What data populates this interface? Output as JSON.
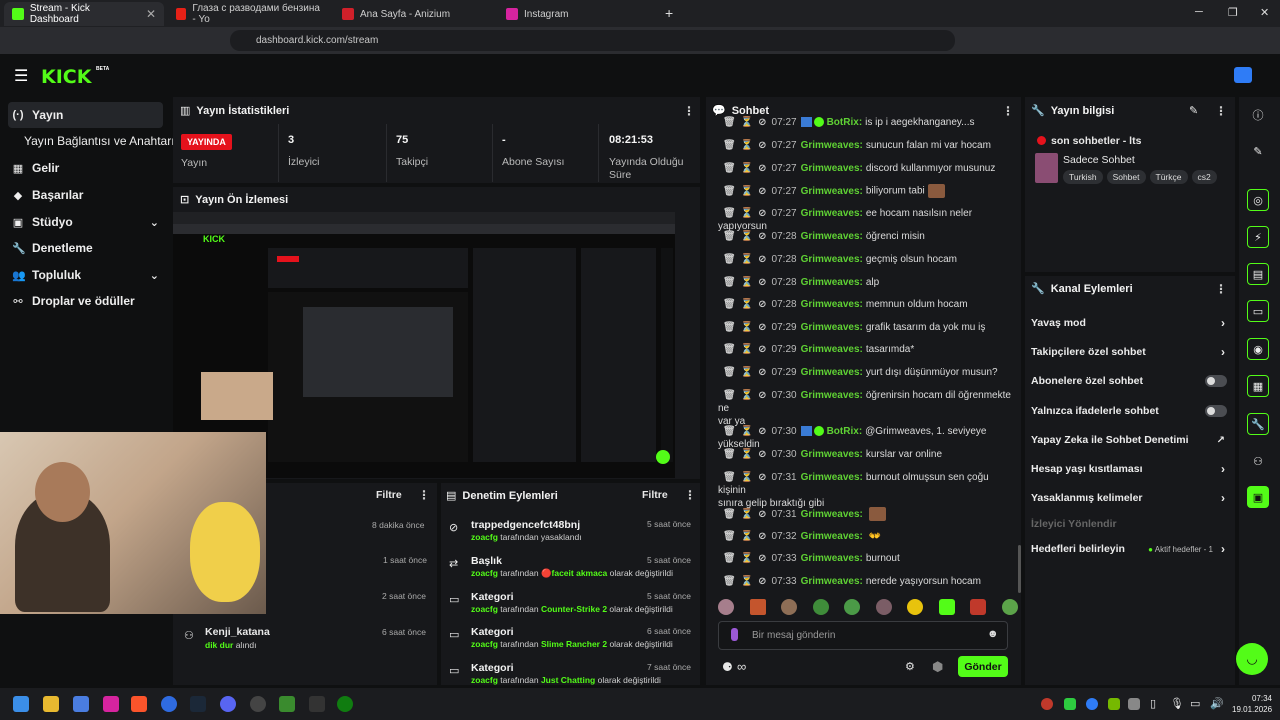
{
  "browser": {
    "tabs": [
      {
        "title": "Stream - Kick Dashboard",
        "color": "#53fc18"
      },
      {
        "title": "Глаза с разводами бензина - Yo",
        "color": "#e62117"
      },
      {
        "title": "Ana Sayfa - Anizium",
        "color": "#d0202a"
      },
      {
        "title": "Instagram",
        "color": "#d6249f"
      }
    ],
    "url": "dashboard.kick.com/stream",
    "new_tab": "+",
    "win_min": "─",
    "win_max": "❐",
    "win_close": "✕"
  },
  "brand": {
    "logo": "KICK",
    "beta": "BETA",
    "accent": "#53fc18"
  },
  "sidebar": {
    "items": [
      {
        "label": "Yayın",
        "icon": "(·)"
      },
      {
        "label": "Yayın Bağlantısı ve Anahtarı",
        "icon": ""
      },
      {
        "label": "Gelir",
        "icon": "▦"
      },
      {
        "label": "Başarılar",
        "icon": "◆"
      },
      {
        "label": "Stüdyo",
        "icon": "▣"
      },
      {
        "label": "Denetleme",
        "icon": "🔧"
      },
      {
        "label": "Topluluk",
        "icon": "👥"
      },
      {
        "label": "Droplar ve ödüller",
        "icon": "⚯"
      }
    ]
  },
  "stats": {
    "title": "Yayın İstatistikleri",
    "live": "YAYINDA",
    "live_label": "Yayın",
    "viewers": "3",
    "viewers_label": "İzleyici",
    "followers": "75",
    "followers_label": "Takipçi",
    "subs": "-",
    "subs_label": "Abone Sayısı",
    "uptime": "08:21:53",
    "uptime_label1": "Yayında Olduğu",
    "uptime_label2": "Süre"
  },
  "preview": {
    "title": "Yayın Ön İzlemesi"
  },
  "lower_left": {
    "filter": "Filtre",
    "times": [
      "8 dakika önce",
      "1 saat önce",
      "2 saat önce"
    ],
    "last_user": "Kenji_katana",
    "last_action": "dik dur",
    "last_action_suffix": " alındı",
    "last_time": "6 saat önce"
  },
  "moderation": {
    "title": "Denetim Eylemleri",
    "filter": "Filtre",
    "rows": [
      {
        "title": "trappedgencefct48bnj",
        "by": "zoacfg",
        "mid": " tarafından yasaklandı",
        "val": "",
        "tail": "",
        "time": "5 saat önce",
        "icon": "⊘"
      },
      {
        "title": "Başlık",
        "by": "zoacfg",
        "mid": " tarafından ",
        "val": "🔴faceit akmaca",
        "tail": " olarak değiştirildi",
        "time": "5 saat önce",
        "icon": "⇄"
      },
      {
        "title": "Kategori",
        "by": "zoacfg",
        "mid": " tarafından ",
        "val": "Counter-Strike 2",
        "tail": " olarak değiştirildi",
        "time": "5 saat önce",
        "icon": "▭"
      },
      {
        "title": "Kategori",
        "by": "zoacfg",
        "mid": " tarafından ",
        "val": "Slime Rancher 2",
        "tail": " olarak değiştirildi",
        "time": "6 saat önce",
        "icon": "▭"
      },
      {
        "title": "Kategori",
        "by": "zoacfg",
        "mid": " tarafından ",
        "val": "Just Chatting",
        "tail": " olarak değiştirildi",
        "time": "7 saat önce",
        "icon": "▭"
      }
    ]
  },
  "chat": {
    "title": "Sohbet",
    "messages": [
      {
        "time": "07:27",
        "user": "BotRix",
        "text": "is ip i aegekhanganey...s",
        "bot": true
      },
      {
        "time": "07:27",
        "user": "Grimweaves",
        "text": "sunucun falan mi var hocam"
      },
      {
        "time": "07:27",
        "user": "Grimweaves",
        "text": "discord kullanmıyor musunuz"
      },
      {
        "time": "07:27",
        "user": "Grimweaves",
        "text": "biliyorum tabi",
        "emote": true
      },
      {
        "time": "07:27",
        "user": "Grimweaves",
        "text": "ee hocam nasılsın neler yapıyorsun"
      },
      {
        "time": "07:28",
        "user": "Grimweaves",
        "text": "öğrenci misin"
      },
      {
        "time": "07:28",
        "user": "Grimweaves",
        "text": "geçmiş olsun hocam"
      },
      {
        "time": "07:28",
        "user": "Grimweaves",
        "text": "alp"
      },
      {
        "time": "07:28",
        "user": "Grimweaves",
        "text": "memnun oldum hocam"
      },
      {
        "time": "07:29",
        "user": "Grimweaves",
        "text": "grafik tasarım da yok mu iş"
      },
      {
        "time": "07:29",
        "user": "Grimweaves",
        "text": "tasarımda*"
      },
      {
        "time": "07:29",
        "user": "Grimweaves",
        "text": "yurt dışı düşünmüyor musun?"
      },
      {
        "time": "07:30",
        "user": "Grimweaves",
        "text": "öğrenirsin hocam dil öğrenmekte ne",
        "cont": "var ya"
      },
      {
        "time": "07:30",
        "user": "BotRix",
        "text": "@Grimweaves, 1. seviyeye yükseldin",
        "bot": true
      },
      {
        "time": "07:30",
        "user": "Grimweaves",
        "text": "kurslar var online"
      },
      {
        "time": "07:31",
        "user": "Grimweaves",
        "text": "burnout olmuşsun sen çoğu kişinin",
        "cont": "sınıra gelip bıraktığı gibi"
      },
      {
        "time": "07:31",
        "user": "Grimweaves",
        "text": "",
        "emote": true
      },
      {
        "time": "07:32",
        "user": "Grimweaves",
        "text": "",
        "hands": "👐"
      },
      {
        "time": "07:33",
        "user": "Grimweaves",
        "text": "burnout"
      },
      {
        "time": "07:33",
        "user": "Grimweaves",
        "text": "nerede yaşıyorsun hocam"
      }
    ],
    "placeholder": "Bir mesaj gönderin",
    "send": "Gönder",
    "infinity": "∞"
  },
  "stream_info": {
    "title": "Yayın bilgisi",
    "stream_title": "son sohbetler - lts",
    "category": "Sadece Sohbet",
    "tags": [
      "Turkish",
      "Sohbet",
      "Türkçe",
      "cs2"
    ]
  },
  "channel_actions": {
    "title": "Kanal Eylemleri",
    "items": [
      {
        "label": "Yavaş mod",
        "type": "chev"
      },
      {
        "label": "Takipçilere özel sohbet",
        "type": "chev"
      },
      {
        "label": "Abonelere özel sohbet",
        "type": "toggle"
      },
      {
        "label": "Yalnızca ifadelerle sohbet",
        "type": "toggle"
      },
      {
        "label": "Yapay Zeka ile Sohbet Denetimi",
        "type": "ext"
      },
      {
        "label": "Hesap yaşı kısıtlaması",
        "type": "chev"
      },
      {
        "label": "Yasaklanmış kelimeler",
        "type": "chev"
      },
      {
        "label": "İzleyici Yönlendir",
        "type": "none",
        "disabled": true
      },
      {
        "label": "Hedefleri belirleyin",
        "type": "goal",
        "extra": "Aktif hedefler - 1"
      }
    ]
  },
  "taskbar": {
    "time": "07:34",
    "date": "19.01.2026"
  }
}
